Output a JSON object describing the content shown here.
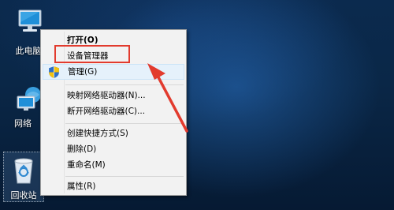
{
  "desktop": {
    "icons": [
      {
        "name": "this-pc",
        "label": "此电脑"
      },
      {
        "name": "network",
        "label": "网络"
      },
      {
        "name": "recycle-bin",
        "label": "回收站"
      }
    ]
  },
  "context_menu": {
    "items": [
      {
        "label": "打开(O)"
      },
      {
        "label": "设备管理器"
      },
      {
        "label": "管理(G)"
      },
      {
        "label": "映射网络驱动器(N)..."
      },
      {
        "label": "断开网络驱动器(C)..."
      },
      {
        "label": "创建快捷方式(S)"
      },
      {
        "label": "删除(D)"
      },
      {
        "label": "重命名(M)"
      },
      {
        "label": "属性(R)"
      }
    ]
  },
  "annotation": {
    "color": "#e23b2e"
  }
}
